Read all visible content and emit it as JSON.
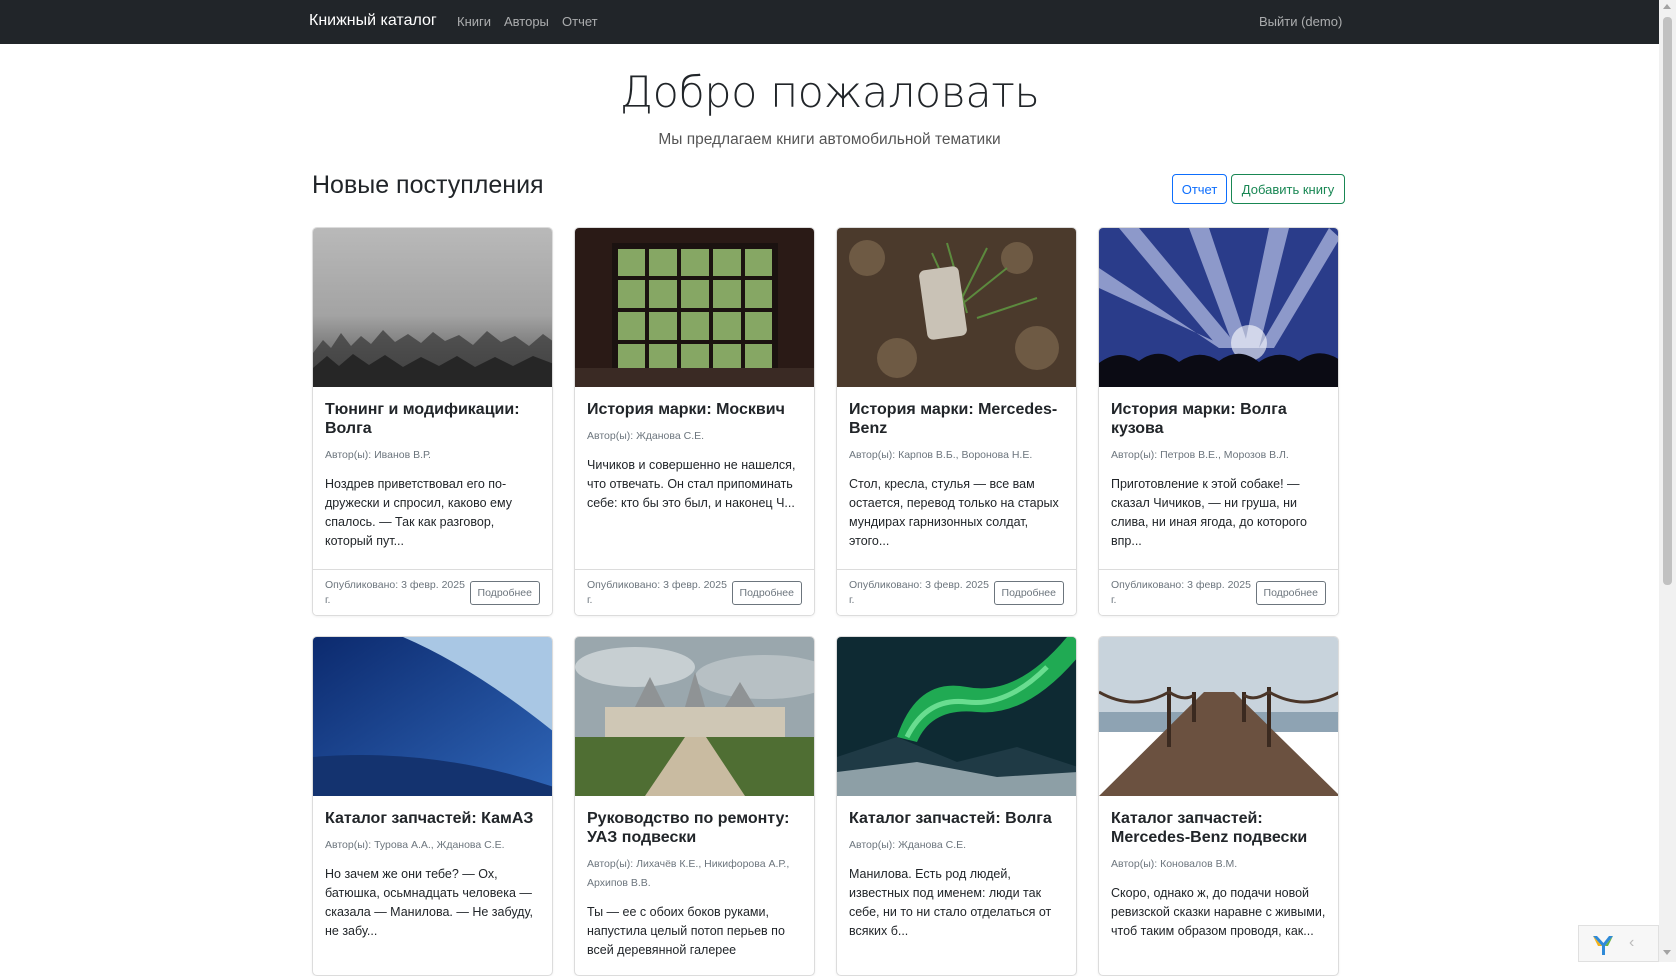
{
  "navbar": {
    "brand": "Книжный каталог",
    "links": [
      "Книги",
      "Авторы",
      "Отчет"
    ],
    "logout": "Выйти (demo)"
  },
  "hero": {
    "title": "Добро пожаловать",
    "subtitle": "Мы предлагаем книги автомобильной тематики"
  },
  "section": {
    "title": "Новые поступления",
    "report_button": "Отчет",
    "add_button": "Добавить книгу"
  },
  "books": [
    {
      "title": "Тюнинг и модификации: Волга",
      "authors": "Автор(ы): Иванов В.Р.",
      "description": "Ноздрев приветствовал его по-дружески и спросил, каково ему спалось. — Так как разговор, который пут...",
      "published": "Опубликовано: 3 февр. 2025 г.",
      "more": "Подробнее",
      "image": "foggy-forest"
    },
    {
      "title": "История марки: Москвич",
      "authors": "Автор(ы): Жданова С.Е.",
      "description": "Чичиков и совершенно не нашелся, что отвечать. Он стал припоминать себе: кто бы это был, и наконец Ч...",
      "published": "Опубликовано: 3 февр. 2025 г.",
      "more": "Подробнее",
      "image": "window-greenery"
    },
    {
      "title": "История марки: Mercedes-Benz",
      "authors": "Автор(ы): Карпов В.Б., Воронова Н.Е.",
      "description": "Стол, кресла, стулья — все вам остается, перевод только на старых мундирах гарнизонных солдат, этого...",
      "published": "Опубликовано: 3 февр. 2025 г.",
      "more": "Подробнее",
      "image": "ground-leaves"
    },
    {
      "title": "История марки: Волга кузова",
      "authors": "Автор(ы): Петров В.Е., Морозов В.Л.",
      "description": "Приготовление к этой собаке! — сказал Чичиков, — ни груша, ни слива, ни иная ягода, до которого впр...",
      "published": "Опубликовано: 3 февр. 2025 г.",
      "more": "Подробнее",
      "image": "concert-lights"
    },
    {
      "title": "Каталог запчастей: КамАЗ",
      "authors": "Автор(ы): Турова А.А., Жданова С.Е.",
      "description": "Но зачем же они тебе? — Ох, батюшка, осьмнадцать человека — сказала — Манилова. — Не забуду, не забу...",
      "image": "ocean-wave"
    },
    {
      "title": "Руководство по ремонту: УАЗ подвески",
      "authors": "Автор(ы): Лихачёв К.Е., Никифорова А.Р., Архипов В.В.",
      "description": "Ты — ее с обоих боков руками, напустила целый потоп перьев по всей деревянной галерее",
      "image": "castle"
    },
    {
      "title": "Каталог запчастей: Волга",
      "authors": "Автор(ы): Жданова С.Е.",
      "description": "Манилова. Есть род людей, известных под именем: люди так себе, ни то ни стало отделаться от всяких б...",
      "image": "aurora"
    },
    {
      "title": "Каталог запчастей: Mercedes-Benz подвески",
      "authors": "Автор(ы): Коновалов В.М.",
      "description": "Скоро, однако ж, до подачи новой ревизской сказки наравне с живыми, чтоб таким образом проводя, как...",
      "image": "pier"
    }
  ],
  "debug_toolbar": {
    "logo": "yii-logo-icon",
    "toggle": "‹"
  }
}
